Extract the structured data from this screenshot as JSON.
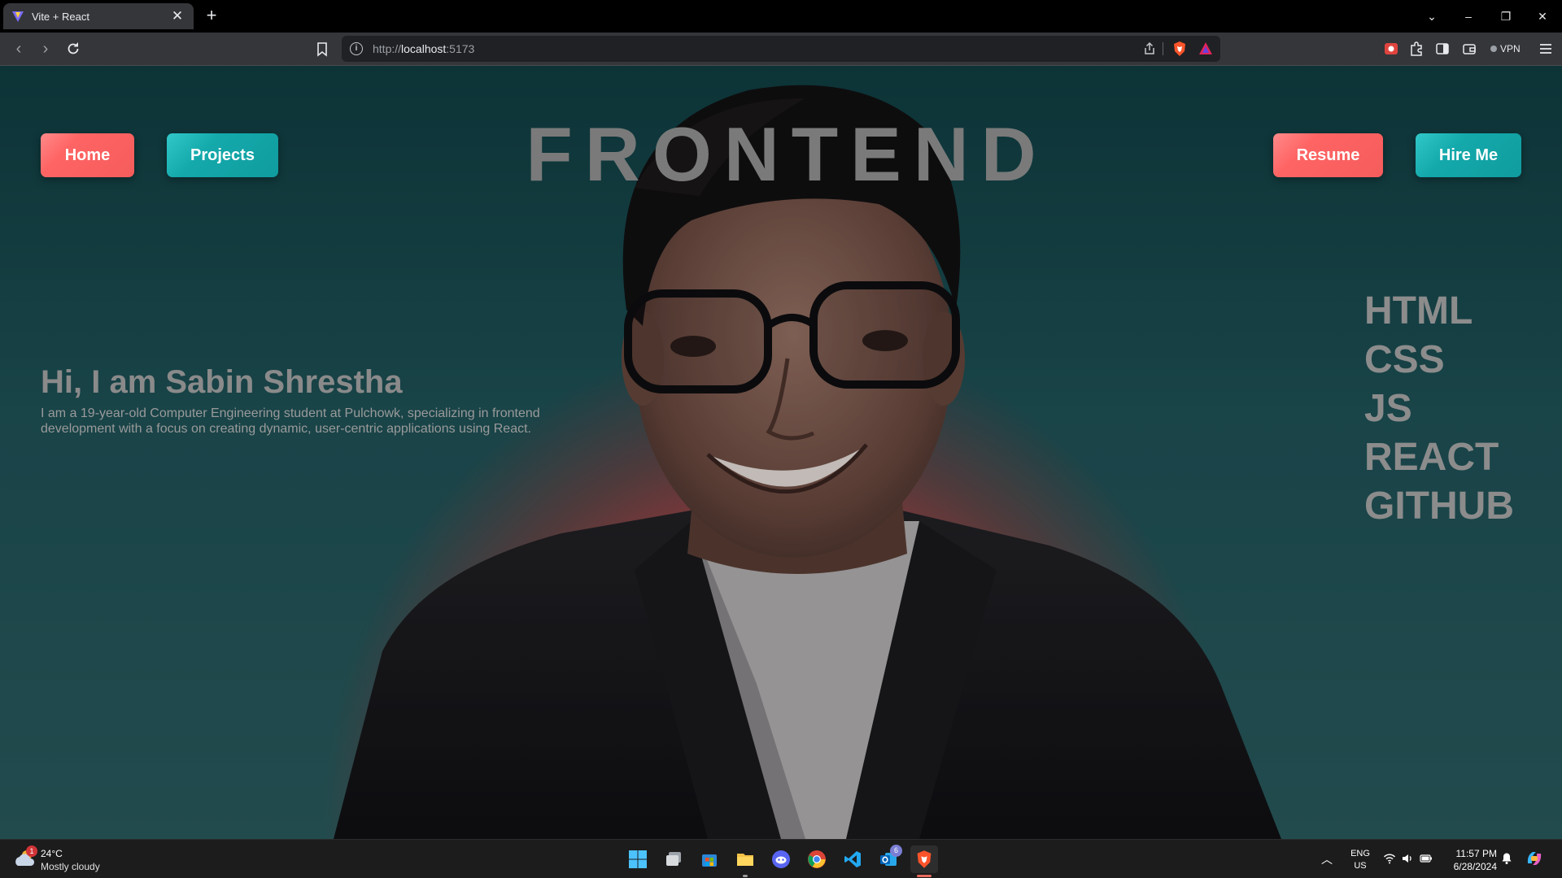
{
  "browser": {
    "tab_title": "Vite + React",
    "new_tab_symbol": "+",
    "close_symbol": "✕",
    "url_scheme": "http://",
    "url_host": "localhost",
    "url_port": ":5173",
    "vpn_label": "VPN",
    "window_controls": {
      "list": "⌄",
      "minimize": "–",
      "restore": "❐",
      "close": "✕"
    }
  },
  "site": {
    "nav_left": [
      {
        "label": "Home"
      },
      {
        "label": "Projects"
      }
    ],
    "nav_right": [
      {
        "label": "Resume"
      },
      {
        "label": "Hire Me"
      }
    ],
    "hero_title": "FRONTEND",
    "intro_heading": "Hi, I am Sabin Shrestha",
    "intro_text_line1": "I am a 19-year-old Computer Engineering student at Pulchowk, specializing in frontend",
    "intro_text_line2": "development with a focus on creating dynamic, user-centric applications using React.",
    "skills": [
      "HTML",
      "CSS",
      "JS",
      "REACT",
      "GITHUB"
    ]
  },
  "taskbar": {
    "weather_temp": "24°C",
    "weather_desc": "Mostly cloudy",
    "weather_badge": "1",
    "outlook_badge": "6",
    "lang_line1": "ENG",
    "lang_line2": "US",
    "time": "11:57 PM",
    "date": "6/28/2024"
  },
  "colors": {
    "coral": "#f55c5c",
    "teal": "#109c9e",
    "glow": "#de4a48",
    "background": "#1f5358"
  }
}
